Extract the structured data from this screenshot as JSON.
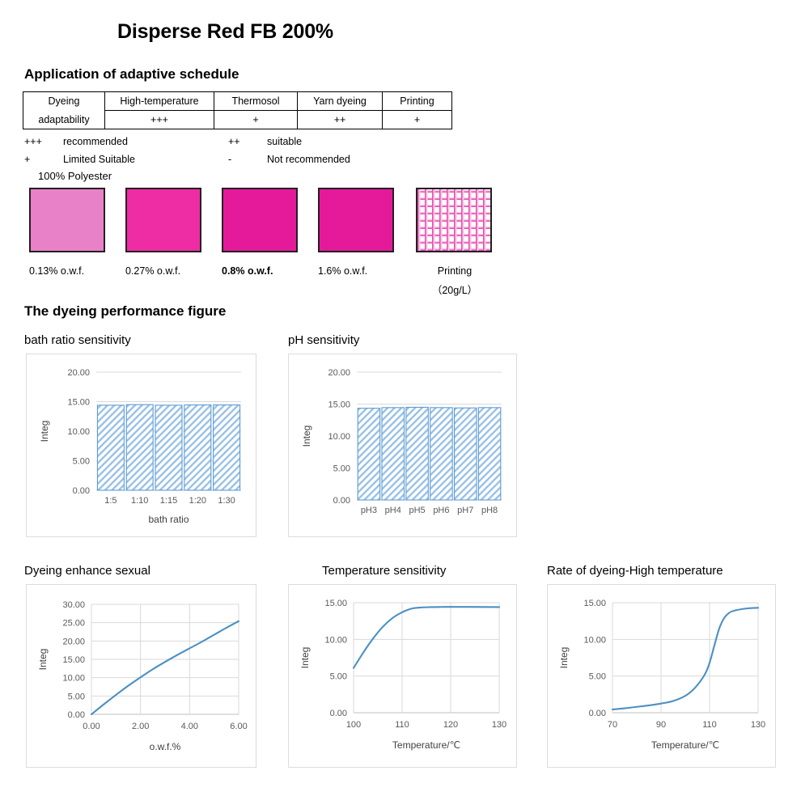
{
  "page_title": "Disperse Red FB 200%",
  "sections": {
    "schedule_heading": "Application of adaptive schedule",
    "performance_heading": "The dyeing performance figure"
  },
  "adaptability_table": {
    "row_header_line1": "Dyeing",
    "row_header_line2": "adaptability",
    "columns": [
      "High-temperature",
      "Thermosol",
      "Yarn dyeing",
      "Printing"
    ],
    "ratings": [
      "+++",
      "+",
      "++",
      "+"
    ]
  },
  "legend": [
    {
      "symbol": "+++",
      "text": "recommended",
      "symbol2": "++",
      "text2": "suitable"
    },
    {
      "symbol": "+",
      "text": "Limited Suitable",
      "symbol2": "-",
      "text2": "Not recommended"
    }
  ],
  "swatches": {
    "substrate_label": "100% Polyester",
    "items": [
      {
        "label": "0.13% o.w.f.",
        "color": "#e881c8",
        "bold": false,
        "type": "solid"
      },
      {
        "label": "0.27% o.w.f.",
        "color": "#ee2ca3",
        "bold": false,
        "type": "solid"
      },
      {
        "label": "0.8% o.w.f.",
        "color": "#e51a9a",
        "bold": true,
        "type": "solid"
      },
      {
        "label": "1.6% o.w.f.",
        "color": "#e51a9a",
        "bold": false,
        "type": "solid"
      },
      {
        "label": "Printing",
        "sub_label": "（20g/L）",
        "color": "#e84bb0",
        "bold": false,
        "type": "printed-mesh"
      }
    ]
  },
  "chart_data": [
    {
      "id": "bath",
      "type": "bar",
      "title": "bath ratio sensitivity",
      "categories": [
        "1:5",
        "1:10",
        "1:15",
        "1:20",
        "1:30"
      ],
      "values": [
        14.4,
        14.5,
        14.4,
        14.45,
        14.45
      ],
      "xlabel": "bath ratio",
      "ylabel": "Integ",
      "ylim": [
        0,
        20
      ],
      "yticks": [
        "0.00",
        "5.00",
        "10.00",
        "15.00",
        "20.00"
      ],
      "grid": true,
      "legend": "none",
      "bar_color": "#5b9bd5",
      "bar_fill": "diagonal-hatch"
    },
    {
      "id": "ph",
      "type": "bar",
      "title": "pH sensitivity",
      "categories": [
        "pH3",
        "pH4",
        "pH5",
        "pH6",
        "pH7",
        "pH8"
      ],
      "values": [
        14.35,
        14.45,
        14.5,
        14.45,
        14.4,
        14.45
      ],
      "xlabel": "",
      "ylabel": "Integ",
      "ylim": [
        0,
        20
      ],
      "yticks": [
        "0.00",
        "5.00",
        "10.00",
        "15.00",
        "20.00"
      ],
      "grid": true,
      "legend": "none",
      "bar_color": "#5b9bd5",
      "bar_fill": "diagonal-hatch"
    },
    {
      "id": "enhance",
      "type": "line",
      "title": "Dyeing enhance sexual",
      "x": [
        0.0,
        0.5,
        1.0,
        1.5,
        2.0,
        2.5,
        3.0,
        3.5,
        4.0,
        4.5,
        5.0,
        5.5,
        6.0
      ],
      "values": [
        0.0,
        2.7,
        5.3,
        7.8,
        10.1,
        12.3,
        14.3,
        16.2,
        18.0,
        19.8,
        21.7,
        23.6,
        25.4
      ],
      "xlabel": "o.w.f.%",
      "ylabel": "Integ",
      "xlim": [
        0,
        6
      ],
      "ylim": [
        0,
        30
      ],
      "xticks": [
        "0.00",
        "2.00",
        "4.00",
        "6.00"
      ],
      "yticks": [
        "0.00",
        "5.00",
        "10.00",
        "15.00",
        "20.00",
        "25.00",
        "30.00"
      ],
      "grid": true,
      "legend": "none",
      "line_color": "#4a90c4"
    },
    {
      "id": "temperature",
      "type": "line",
      "title": "Temperature sensitivity",
      "x": [
        100,
        102,
        104,
        106,
        108,
        110,
        112,
        114,
        116,
        118,
        120,
        124,
        130
      ],
      "values": [
        6.1,
        8.2,
        10.1,
        11.7,
        12.9,
        13.7,
        14.2,
        14.35,
        14.4,
        14.42,
        14.43,
        14.43,
        14.4
      ],
      "xlabel": "Temperature/℃",
      "ylabel": "Integ",
      "xlim": [
        100,
        130
      ],
      "ylim": [
        0,
        15
      ],
      "xticks": [
        "100",
        "110",
        "120",
        "130"
      ],
      "yticks": [
        "0.00",
        "5.00",
        "10.00",
        "15.00"
      ],
      "grid": true,
      "legend": "none",
      "line_color": "#4a90c4"
    },
    {
      "id": "rate",
      "type": "line",
      "title": "Rate of dyeing-High temperature",
      "x": [
        70,
        75,
        80,
        85,
        90,
        95,
        100,
        104,
        108,
        110,
        112,
        114,
        116,
        118,
        120,
        125,
        130
      ],
      "values": [
        0.45,
        0.6,
        0.8,
        1.0,
        1.25,
        1.6,
        2.3,
        3.4,
        5.2,
        6.8,
        9.2,
        11.5,
        12.9,
        13.6,
        13.9,
        14.2,
        14.3
      ],
      "xlabel": "Temperature/℃",
      "ylabel": "Integ",
      "xlim": [
        70,
        130
      ],
      "ylim": [
        0,
        15
      ],
      "xticks": [
        "70",
        "90",
        "110",
        "130"
      ],
      "yticks": [
        "0.00",
        "5.00",
        "10.00",
        "15.00"
      ],
      "grid": true,
      "legend": "none",
      "line_color": "#4a90c4"
    }
  ]
}
